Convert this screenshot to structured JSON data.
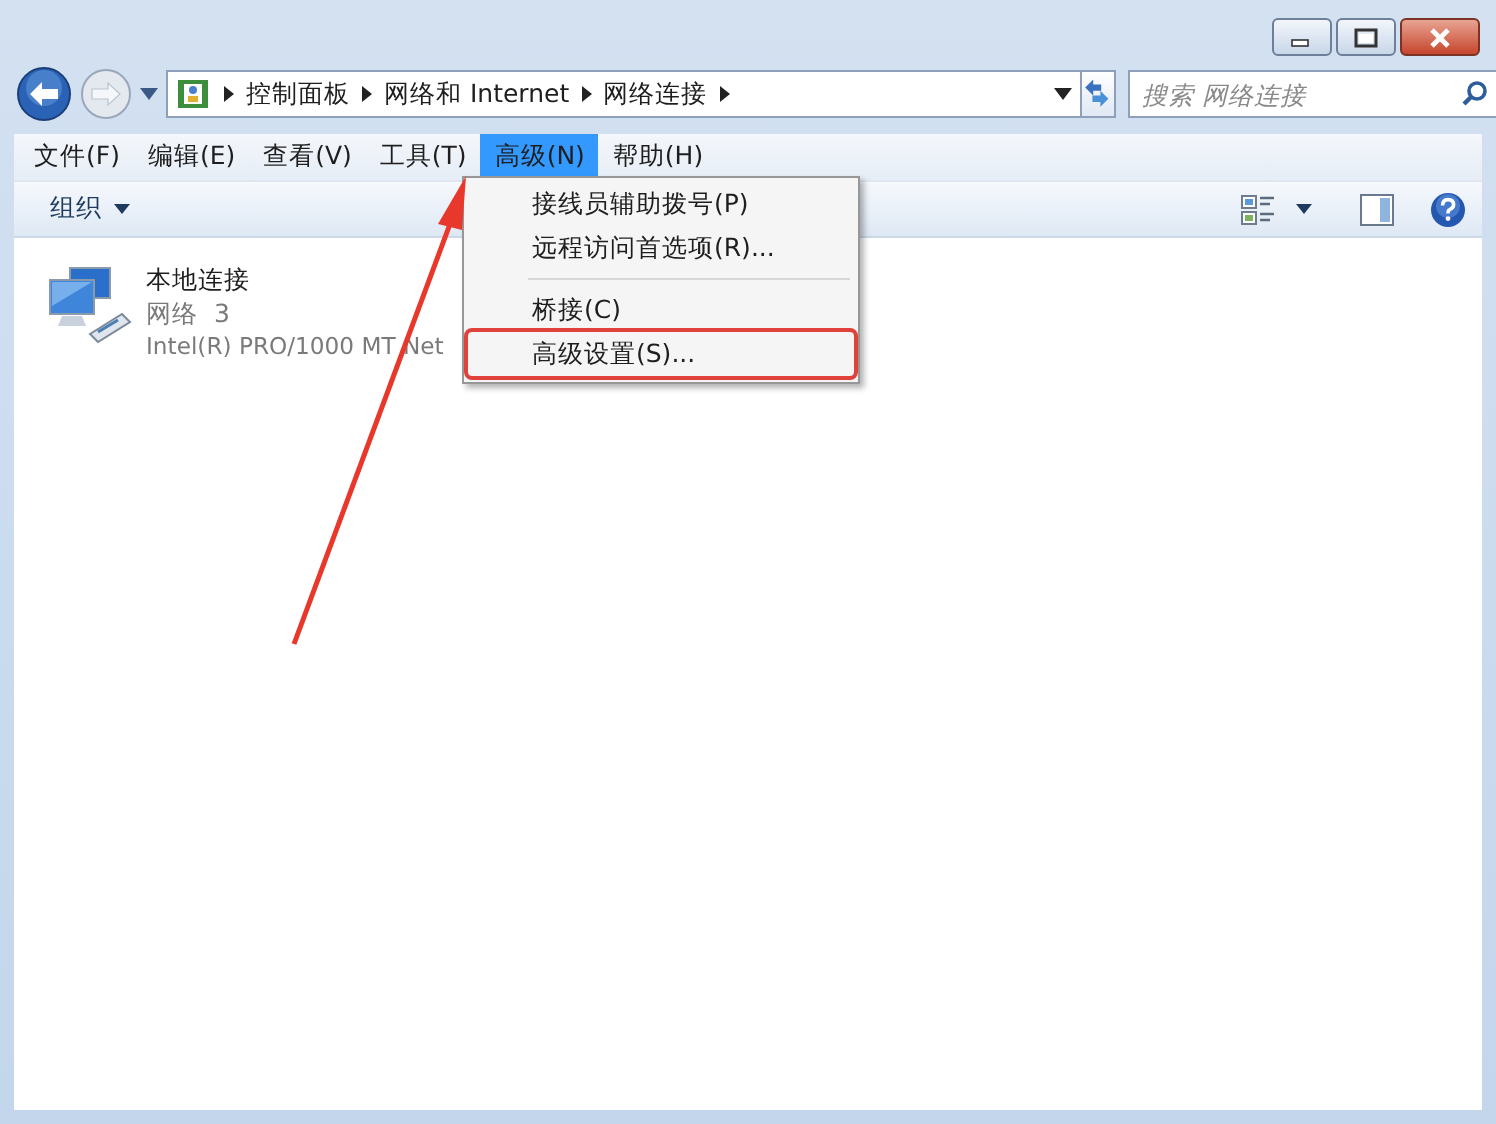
{
  "address_bar": {
    "crumbs": [
      "控制面板",
      "网络和 Internet",
      "网络连接"
    ]
  },
  "search": {
    "placeholder": "搜索 网络连接"
  },
  "menu_bar": [
    {
      "label": "文件(F)",
      "selected": false
    },
    {
      "label": "编辑(E)",
      "selected": false
    },
    {
      "label": "查看(V)",
      "selected": false
    },
    {
      "label": "工具(T)",
      "selected": false
    },
    {
      "label": "高级(N)",
      "selected": true
    },
    {
      "label": "帮助(H)",
      "selected": false
    }
  ],
  "toolbar": {
    "organize": "组织"
  },
  "connections": [
    {
      "name": "本地连接",
      "network": "网络  3",
      "adapter": "Intel(R) PRO/1000 MT Net"
    }
  ],
  "dropdown": {
    "items": [
      {
        "kind": "item",
        "label": "接线员辅助拨号(P)",
        "annotated": false
      },
      {
        "kind": "item",
        "label": "远程访问首选项(R)...",
        "annotated": false
      },
      {
        "kind": "separator"
      },
      {
        "kind": "item",
        "label": "桥接(C)",
        "annotated": false
      },
      {
        "kind": "item",
        "label": "高级设置(S)...",
        "annotated": true
      }
    ]
  }
}
